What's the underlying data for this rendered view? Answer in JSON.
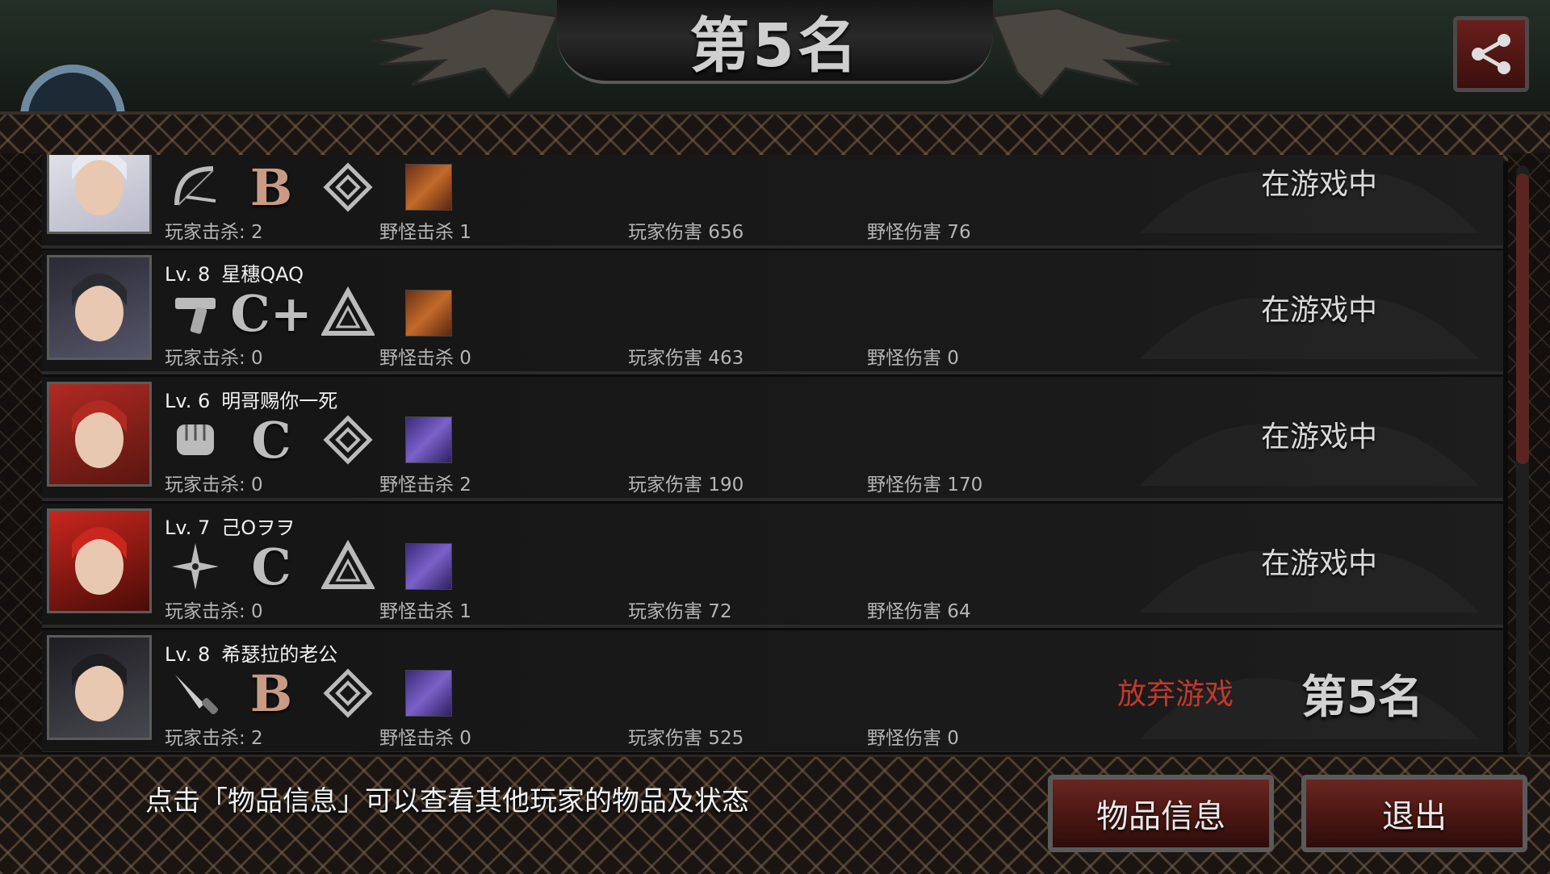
{
  "header": {
    "title": "第5名",
    "player_name_partial": "希瑟拉的老公"
  },
  "players": [
    {
      "level_label": "",
      "name": "",
      "portrait": "white-haired-girl",
      "weapon_icon": "bow-icon",
      "grade": "B",
      "armor_icon": "diamond-emblem-icon",
      "item_color": "orange",
      "player_kills": "玩家击杀: 2",
      "monster_kills": "野怪击杀 1",
      "player_damage": "玩家伤害 656",
      "monster_damage": "野怪伤害 76",
      "status": "在游戏中"
    },
    {
      "level_label": "Lv. 8",
      "name": "星穗QAQ",
      "portrait": "dark-haired-girl",
      "weapon_icon": "pistol-icon",
      "grade": "C+",
      "armor_icon": "triangle-emblem-icon",
      "item_color": "orange",
      "player_kills": "玩家击杀: 0",
      "monster_kills": "野怪击杀 0",
      "player_damage": "玩家伤害 463",
      "monster_damage": "野怪伤害 0",
      "status": "在游戏中"
    },
    {
      "level_label": "Lv. 6",
      "name": "明哥赐你一死",
      "portrait": "red-haired-boy",
      "weapon_icon": "fist-icon",
      "grade": "C",
      "armor_icon": "diamond-emblem-icon",
      "item_color": "purple",
      "player_kills": "玩家击杀: 0",
      "monster_kills": "野怪击杀 2",
      "player_damage": "玩家伤害 190",
      "monster_damage": "野怪伤害 170",
      "status": "在游戏中"
    },
    {
      "level_label": "Lv. 7",
      "name": "己Oヲヲ",
      "portrait": "red-haired-girl",
      "weapon_icon": "shuriken-icon",
      "grade": "C",
      "armor_icon": "triangle-emblem-icon",
      "item_color": "purple",
      "player_kills": "玩家击杀: 0",
      "monster_kills": "野怪击杀 1",
      "player_damage": "玩家伤害 72",
      "monster_damage": "野怪伤害 64",
      "status": "在游戏中"
    },
    {
      "level_label": "Lv. 8",
      "name": "希瑟拉的老公",
      "portrait": "black-haired-boy",
      "weapon_icon": "knife-icon",
      "grade": "B",
      "armor_icon": "diamond-emblem-icon",
      "item_color": "purple",
      "player_kills": "玩家击杀: 2",
      "monster_kills": "野怪击杀 0",
      "player_damage": "玩家伤害 525",
      "monster_damage": "野怪伤害 0",
      "abandon_label": "放弃游戏",
      "rank": "第5名"
    }
  ],
  "footer": {
    "hint": "点击「物品信息」可以查看其他玩家的物品及状态",
    "items_button": "物品信息",
    "exit_button": "退出"
  },
  "colors": {
    "accent_red": "#c0392b",
    "button_red": "#4a1612"
  }
}
